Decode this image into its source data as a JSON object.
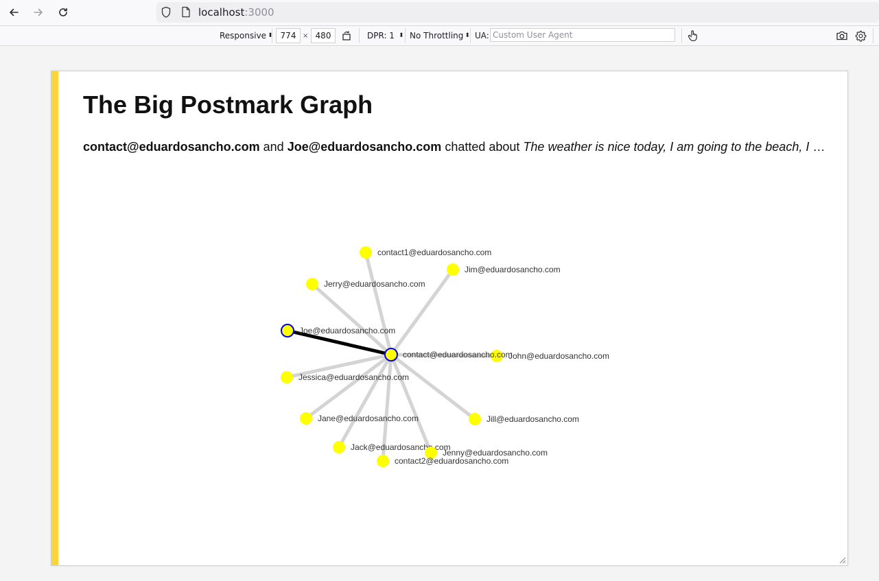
{
  "browser": {
    "url_host": "localhost",
    "url_port": ":3000"
  },
  "rdm_toolbar": {
    "device": "Responsive",
    "width": "774",
    "times": "×",
    "height": "480",
    "dpr": "DPR: 1",
    "throttling": "No Throttling",
    "ua_label": "UA:",
    "ua_placeholder": "Custom User Agent"
  },
  "page": {
    "title": "The Big Postmark Graph",
    "summary": {
      "from": "contact@eduardosancho.com",
      "and": "and",
      "to": "Joe@eduardosancho.com",
      "chatted": "chatted about",
      "subject": "The weather is nice today, I am going to the beach, I am going to the beach, I am going to the beach"
    }
  },
  "graph": {
    "center": "contact@eduardosancho.com",
    "colors": {
      "node": "#ffff00",
      "selected_stroke": "#0000ee",
      "edge": "#cccccc",
      "selected_edge": "#000000"
    },
    "nodes": [
      {
        "id": "contact1@eduardosancho.com",
        "selected": false
      },
      {
        "id": "Jim@eduardosancho.com",
        "selected": false
      },
      {
        "id": "Jerry@eduardosancho.com",
        "selected": false
      },
      {
        "id": "Joe@eduardosancho.com",
        "selected": true
      },
      {
        "id": "contact@eduardosancho.com",
        "selected": true
      },
      {
        "id": "John@eduardosancho.com",
        "selected": false
      },
      {
        "id": "Jessica@eduardosancho.com",
        "selected": false
      },
      {
        "id": "Jane@eduardosancho.com",
        "selected": false
      },
      {
        "id": "Jill@eduardosancho.com",
        "selected": false
      },
      {
        "id": "Jack@eduardosancho.com",
        "selected": false
      },
      {
        "id": "Jenny@eduardosancho.com",
        "selected": false
      },
      {
        "id": "contact2@eduardosancho.com",
        "selected": false
      }
    ]
  }
}
